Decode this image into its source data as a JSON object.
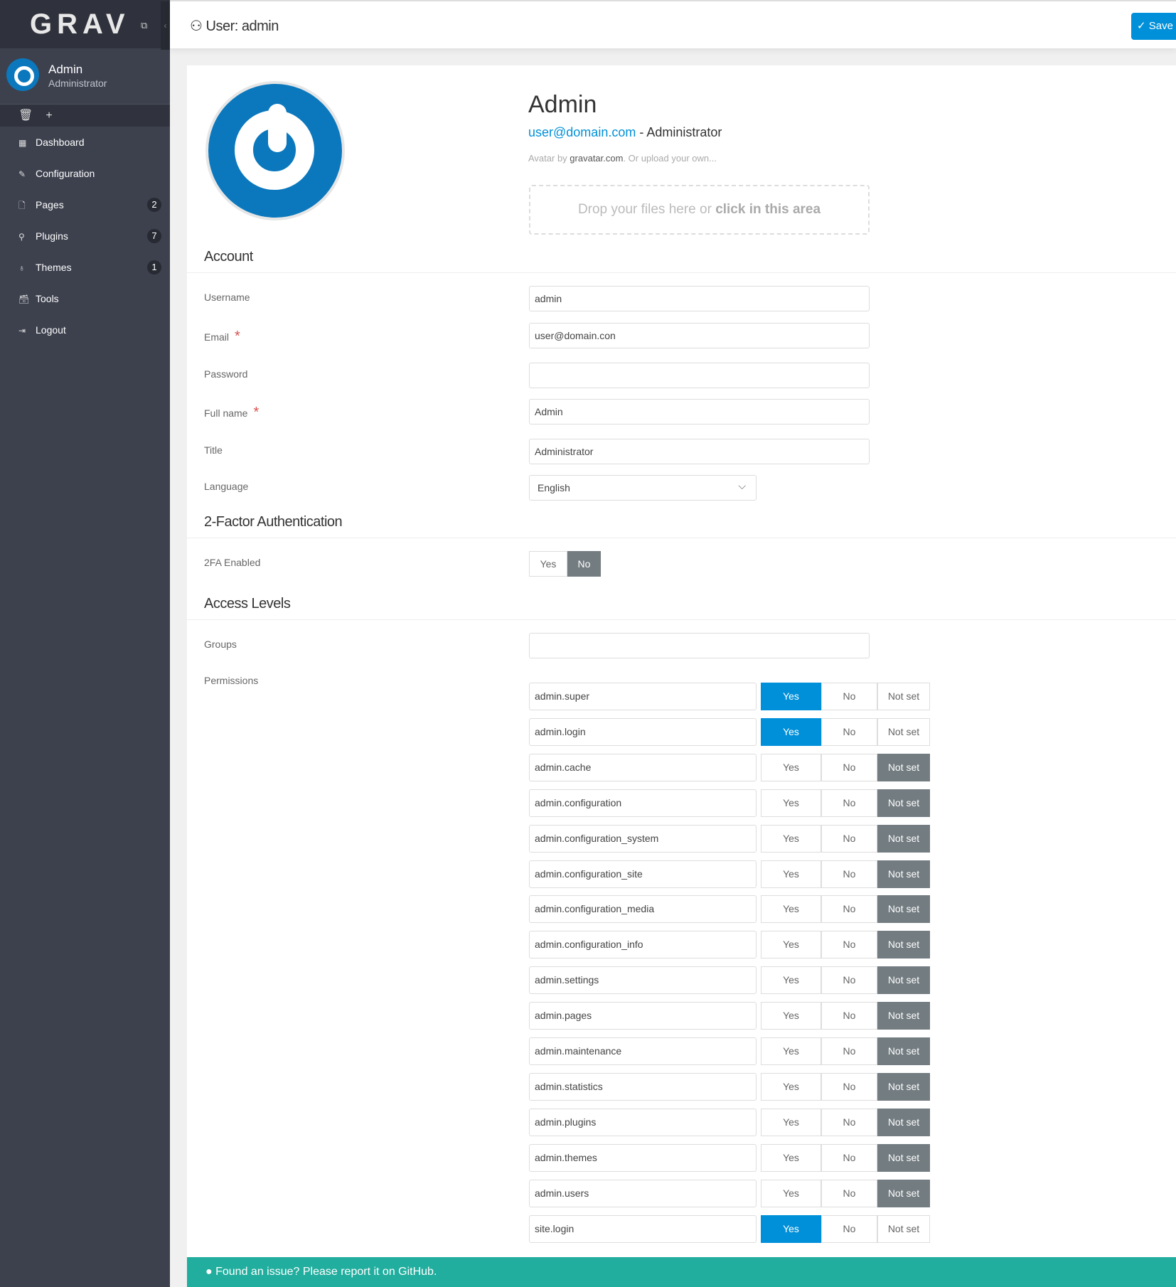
{
  "sidebar": {
    "logo": "GRAV",
    "user_name": "Admin",
    "user_role": "Administrator",
    "items": [
      {
        "label": "Dashboard",
        "icon": "▦"
      },
      {
        "label": "Configuration",
        "icon": "✎"
      },
      {
        "label": "Pages",
        "icon": "🗋",
        "badge": "2"
      },
      {
        "label": "Plugins",
        "icon": "⚲",
        "badge": "7"
      },
      {
        "label": "Themes",
        "icon": "♁",
        "badge": "1"
      },
      {
        "label": "Tools",
        "icon": "🗃"
      },
      {
        "label": "Logout",
        "icon": "⇥"
      }
    ]
  },
  "header": {
    "title": "User: admin",
    "save_label": "Save"
  },
  "profile": {
    "name": "Admin",
    "email": "user@domain.com",
    "role": " - Administrator",
    "avatar_by": "Avatar by ",
    "gravatar": "gravatar.com",
    "upload": ". Or upload your own...",
    "drop_text": "Drop your files here or ",
    "drop_bold": "click in this area"
  },
  "account": {
    "heading": "Account",
    "username_label": "Username",
    "username": "admin",
    "email_label": "Email",
    "email": "user@domain.con",
    "password_label": "Password",
    "password": "",
    "fullname_label": "Full name",
    "fullname": "Admin",
    "title_label": "Title",
    "title": "Administrator",
    "language_label": "Language",
    "language": "English"
  },
  "twofa": {
    "heading": "2-Factor Authentication",
    "label": "2FA Enabled",
    "yes": "Yes",
    "no": "No",
    "value": "No"
  },
  "access": {
    "heading": "Access Levels",
    "groups_label": "Groups",
    "groups": "",
    "permissions_label": "Permissions",
    "options": {
      "yes": "Yes",
      "no": "No",
      "notset": "Not set"
    },
    "permissions": [
      {
        "name": "admin.super",
        "value": "yes"
      },
      {
        "name": "admin.login",
        "value": "yes"
      },
      {
        "name": "admin.cache",
        "value": "notset"
      },
      {
        "name": "admin.configuration",
        "value": "notset"
      },
      {
        "name": "admin.configuration_system",
        "value": "notset"
      },
      {
        "name": "admin.configuration_site",
        "value": "notset"
      },
      {
        "name": "admin.configuration_media",
        "value": "notset"
      },
      {
        "name": "admin.configuration_info",
        "value": "notset"
      },
      {
        "name": "admin.settings",
        "value": "notset"
      },
      {
        "name": "admin.pages",
        "value": "notset"
      },
      {
        "name": "admin.maintenance",
        "value": "notset"
      },
      {
        "name": "admin.statistics",
        "value": "notset"
      },
      {
        "name": "admin.plugins",
        "value": "notset"
      },
      {
        "name": "admin.themes",
        "value": "notset"
      },
      {
        "name": "admin.users",
        "value": "notset"
      },
      {
        "name": "site.login",
        "value": "yes"
      }
    ]
  },
  "footer": {
    "text": "Found an issue? Please report it on GitHub."
  }
}
